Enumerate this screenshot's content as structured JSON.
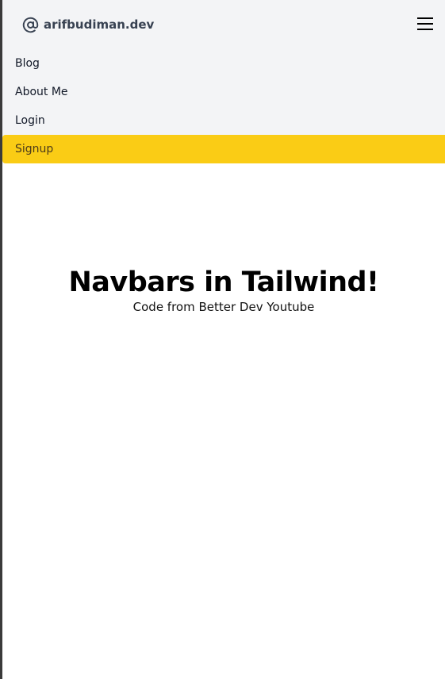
{
  "brand": {
    "name": "arifbudiman.dev",
    "icon": "at-sign-icon"
  },
  "menu": {
    "icon": "hamburger-menu-icon"
  },
  "nav": {
    "links": [
      {
        "label": "Blog"
      },
      {
        "label": "About Me"
      },
      {
        "label": "Login"
      },
      {
        "label": "Signup"
      }
    ]
  },
  "hero": {
    "title": "Navbars in Tailwind!",
    "subtitle": "Code from Better Dev Youtube"
  },
  "colors": {
    "nav_background": "#f3f4f6",
    "signup_background": "#facc15",
    "brand_text": "#374151"
  }
}
